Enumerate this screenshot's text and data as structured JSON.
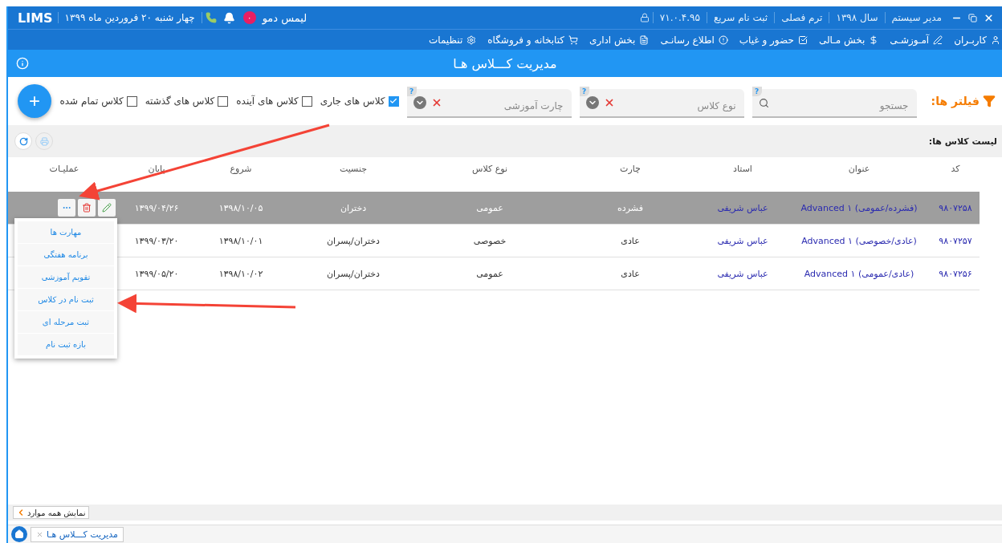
{
  "top_bar": {
    "right_items": [
      "مدیر سیستم",
      "سال ۱۳۹۸",
      "ترم فصلی",
      "ثبت نام سریع",
      "۷۱.۰.۴.۹۵"
    ],
    "user_name": "لیمس دمو",
    "notification_count": "۰",
    "date": "چهار شنبه ۲۰ فروردین ماه ۱۳۹۹",
    "logo": "LIMS"
  },
  "menu": [
    "کاربـران",
    "آمـوزشـی",
    "بخش مـالی",
    "حضور و غیاب",
    "اطلاع رسانـی",
    "بخش اداری",
    "کتابخانه و فروشگاه",
    "تنظیمات"
  ],
  "page_title": "مدیریت کـــلاس هـا",
  "filters": {
    "label": "فیلتر ها:",
    "fields": [
      {
        "kind": "search",
        "placeholder": "جستجو",
        "help": "?"
      },
      {
        "kind": "select",
        "placeholder": "نوع کلاس",
        "help": "?"
      },
      {
        "kind": "select",
        "placeholder": "چارت آموزشی",
        "help": "?"
      }
    ],
    "checkboxes": [
      {
        "label": "کلاس های جاری",
        "checked": true
      },
      {
        "label": "کلاس های آینده",
        "checked": false
      },
      {
        "label": "کلاس های گذشته",
        "checked": false
      },
      {
        "label": "کلاس تمام شده",
        "checked": false
      }
    ],
    "add_button": "+"
  },
  "list_title": "لیست کلاس ها:",
  "table": {
    "columns": [
      "کد",
      "عنوان",
      "استاد",
      "چارت",
      "نوع کلاس",
      "جنسیت",
      "شروع",
      "پایان",
      "عملیـات"
    ],
    "rows": [
      {
        "selected": true,
        "cells": [
          "۹۸۰۷۲۵۸",
          "(فشرده/عمومی) Advanced ۱",
          "عباس شریفی",
          "فشرده",
          "عمومی",
          "دختران",
          "۱۳۹۸/۱۰/۰۵",
          "۱۳۹۹/۰۴/۲۶"
        ]
      },
      {
        "selected": false,
        "cells": [
          "۹۸۰۷۲۵۷",
          "(عادی/خصوصی) Advanced ۱",
          "عباس شریفی",
          "عادی",
          "خصوصی",
          "دختران/پسران",
          "۱۳۹۸/۱۰/۰۱",
          "۱۳۹۹/۰۳/۲۰"
        ]
      },
      {
        "selected": false,
        "cells": [
          "۹۸۰۷۲۵۶",
          "(عادی/عمومی) Advanced ۱",
          "عباس شریفی",
          "عادی",
          "عمومی",
          "دختران/پسران",
          "۱۳۹۸/۱۰/۰۲",
          "۱۳۹۹/۰۵/۲۰"
        ]
      }
    ]
  },
  "row_menu": [
    "مهارت ها",
    "برنامه هفتگی",
    "تقویم آموزشی",
    "ثبت نام در کلاس",
    "ثبت مرحله ای",
    "بازه ثبت نام"
  ],
  "show_all": "نمایش همه موارد",
  "bottom_tabs": [
    {
      "label": "مدیریت کـــلاس هـا",
      "selected": true
    }
  ]
}
